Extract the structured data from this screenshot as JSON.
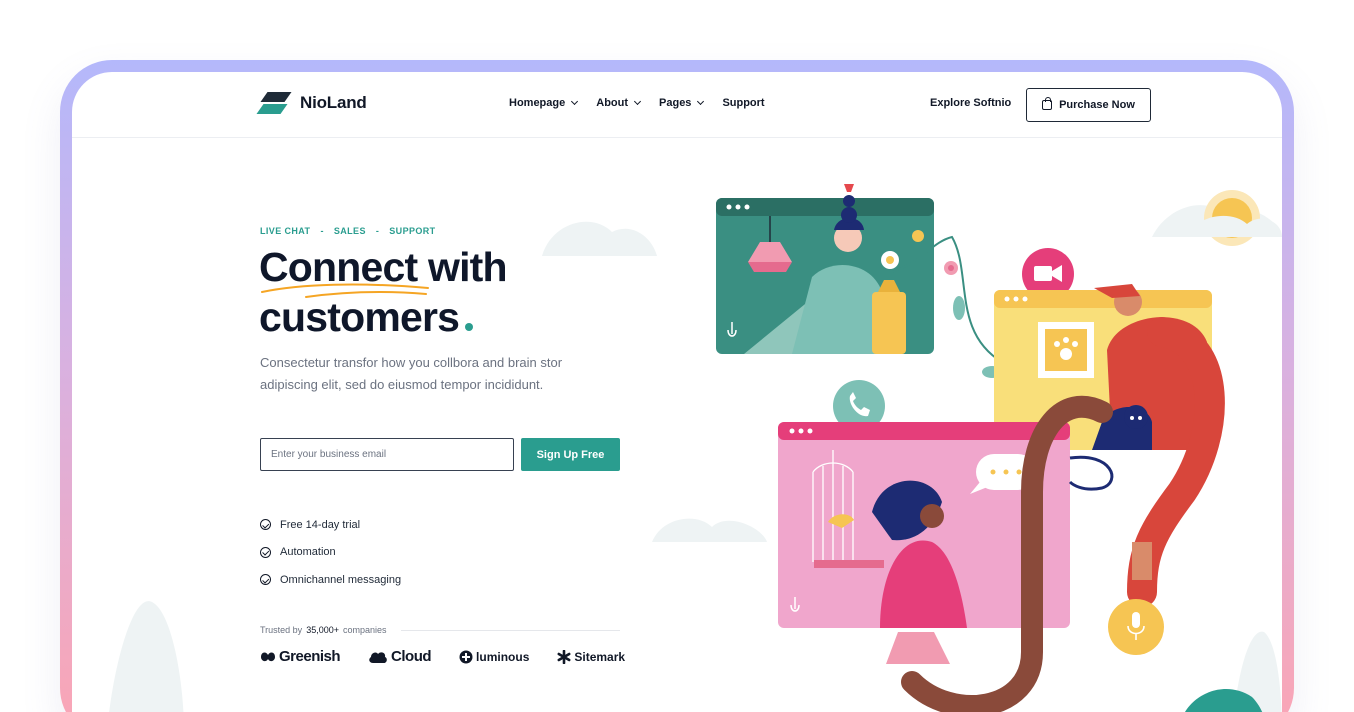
{
  "nav": {
    "brand": "NioLand",
    "menu": [
      {
        "label": "Homepage",
        "dropdown": true
      },
      {
        "label": "About",
        "dropdown": true
      },
      {
        "label": "Pages",
        "dropdown": true
      },
      {
        "label": "Support",
        "dropdown": false
      }
    ],
    "explore_label": "Explore Softnio",
    "purchase_label": "Purchase Now"
  },
  "hero": {
    "eyebrow": [
      "LIVE CHAT",
      "SALES",
      "SUPPORT"
    ],
    "eyebrow_sep": "-",
    "title_line1_a": "Connect",
    "title_line1_b": " with",
    "title_line2": "customers",
    "lead": "Consectetur  transfor how you collbora and brain stor adipiscing elit, sed do eiusmod tempor incididunt.",
    "email_placeholder": "Enter your business email",
    "signup_label": "Sign Up Free",
    "features": [
      "Free 14-day trial",
      "Automation",
      "Omnichannel messaging"
    ],
    "trusted_prefix": "Trusted by",
    "trusted_count": "35,000+",
    "trusted_suffix": "companies",
    "brands": [
      "Greenish",
      "Cloud",
      "luminous",
      "Sitemark"
    ]
  },
  "colors": {
    "accent": "#2a9d8f",
    "frame_top": "#b4b8fb",
    "frame_bottom": "#fba5b4",
    "dark": "#0f172a",
    "underline": "#f5a524"
  },
  "icons": [
    "shopping-bag-icon",
    "check-circle-icon",
    "chevron-down-icon",
    "video-camera-icon",
    "phone-icon",
    "microphone-icon",
    "paw-icon"
  ]
}
